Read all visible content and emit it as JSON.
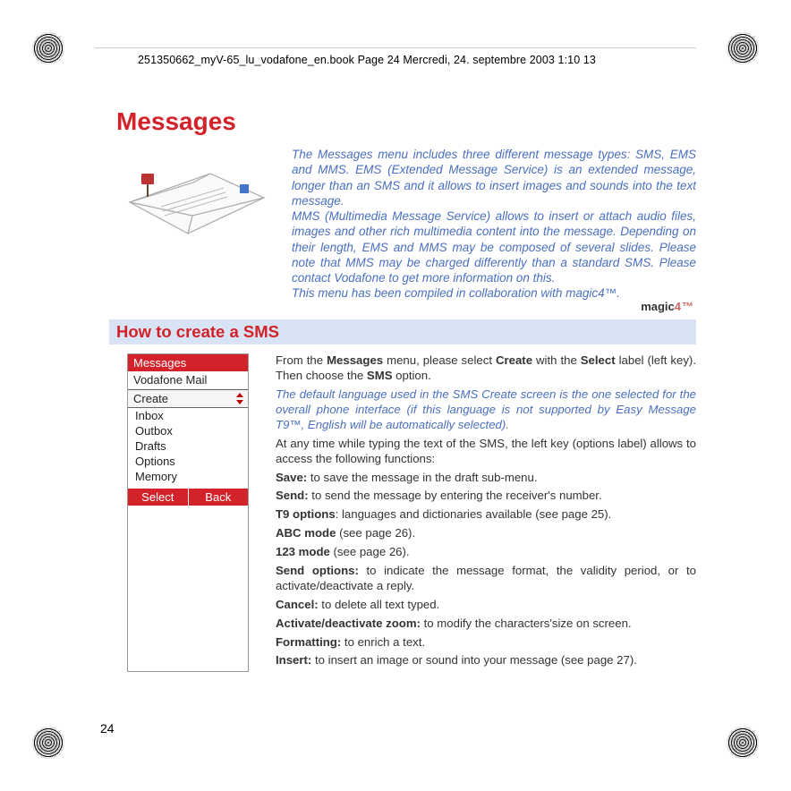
{
  "meta": {
    "header": "251350662_myV-65_lu_vodafone_en.book  Page 24  Mercredi, 24. septembre 2003  1:10 13"
  },
  "title": "Messages",
  "intro": {
    "p1": "The Messages menu includes three different message types: SMS, EMS and MMS. EMS (Extended Message Service) is an extended message, longer than an SMS and it allows to insert images and sounds into the text message.",
    "p2": "MMS (Multimedia Message Service) allows to insert or attach audio files, images and other rich multimedia content into the message. Depending on their length, EMS and MMS may be composed of several slides. Please note that MMS may be charged differently than a standard SMS. Please contact Vodafone to get more information on this.",
    "p3": "This menu has been compiled in collaboration with magic4™.",
    "brand": "magic",
    "brand_suffix": "4™"
  },
  "section_heading": "How to create a SMS",
  "phone": {
    "title": "Messages",
    "items": [
      "Vodafone Mail",
      "Create",
      "Inbox",
      "Outbox",
      "Drafts",
      "Options",
      "Memory"
    ],
    "soft_left": "Select",
    "soft_right": "Back"
  },
  "instr": {
    "lead_a": "From the ",
    "lead_b": "Messages",
    "lead_c": " menu, please select ",
    "lead_d": "Create",
    "lead_e": " with the ",
    "lead_f": "Select",
    "lead_g": " label (left key). Then choose the ",
    "lead_h": "SMS",
    "lead_i": " option.",
    "lang_note": "The default language used in the SMS Create screen is the one selected for the overall phone interface (if this language is not supported by Easy Message T9™, English will be automatically selected).",
    "anytime": "At any time while typing the text of the SMS, the left key (options label) allows to access the following functions:",
    "opts": [
      {
        "k": "Save:",
        "v": " to save the message in the draft sub-menu."
      },
      {
        "k": "Send:",
        "v": " to send the message by entering the receiver's number."
      },
      {
        "k": "T9 options",
        "v": ": languages and dictionaries available (see page 25)."
      },
      {
        "k": "ABC mode",
        "v": " (see page 26)."
      },
      {
        "k": "123 mode",
        "v": " (see page 26)."
      },
      {
        "k": "Send options:",
        "v": " to indicate the message format, the validity period, or to activate/deactivate a reply."
      },
      {
        "k": "Cancel:",
        "v": " to delete all text typed."
      },
      {
        "k": "Activate/deactivate zoom:",
        "v": " to modify the characters'size on screen."
      },
      {
        "k": "Formatting:",
        "v": " to enrich a text."
      },
      {
        "k": "Insert:",
        "v": " to insert an image or sound into your message (see page 27)."
      }
    ]
  },
  "page_number": "24"
}
